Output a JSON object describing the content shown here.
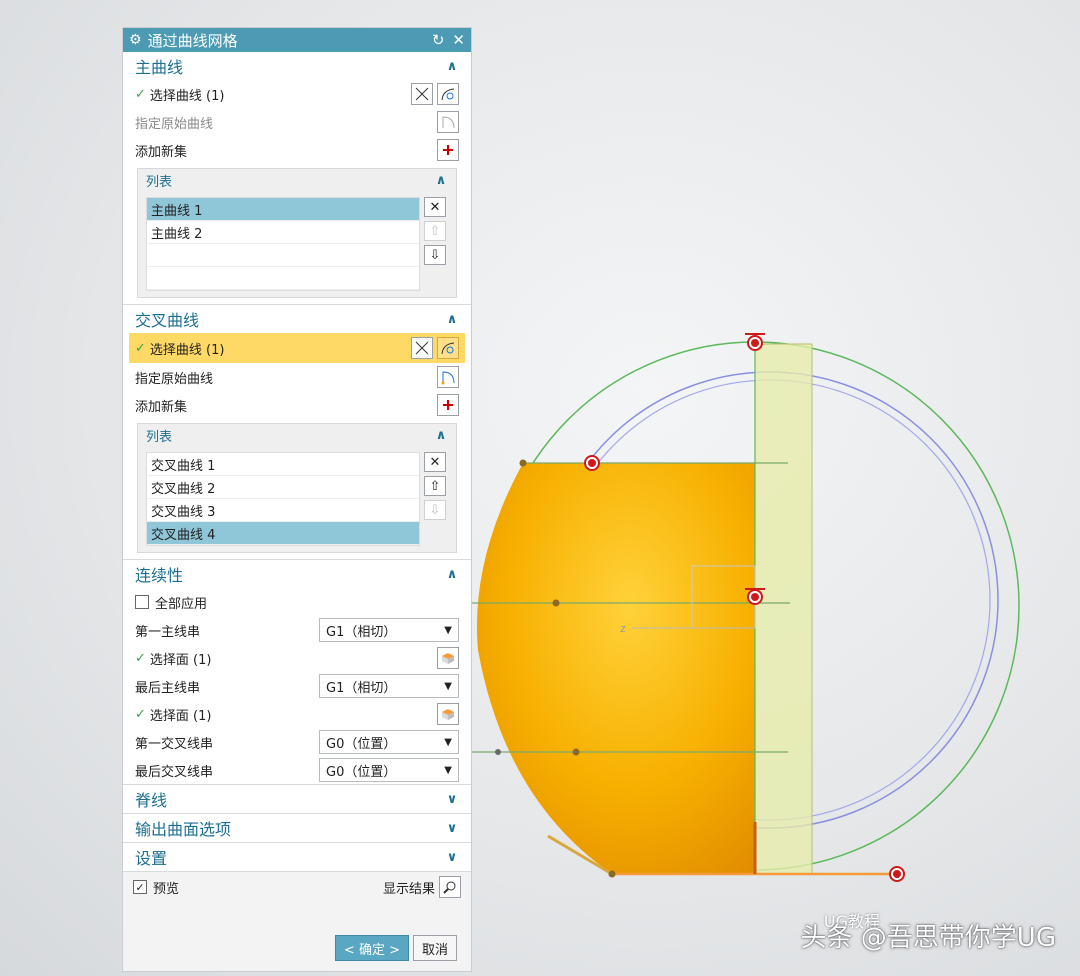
{
  "dialog": {
    "title": "通过曲线网格",
    "reset_glyph": "↻",
    "close_glyph": "✕"
  },
  "main_curves": {
    "header": "主曲线",
    "select_curve": "选择曲线 (1)",
    "specify_origin": "指定原始曲线",
    "add_new_set": "添加新集",
    "list_header": "列表",
    "items": [
      "主曲线 1",
      "主曲线 2"
    ]
  },
  "cross_curves": {
    "header": "交叉曲线",
    "select_curve": "选择曲线 (1)",
    "specify_origin": "指定原始曲线",
    "add_new_set": "添加新集",
    "list_header": "列表",
    "items": [
      "交叉曲线 1",
      "交叉曲线 2",
      "交叉曲线 3",
      "交叉曲线 4"
    ]
  },
  "continuity": {
    "header": "连续性",
    "apply_all": "全部应用",
    "first_primary": "第一主线串",
    "first_primary_value": "G1（相切）",
    "select_face_1": "选择面 (1)",
    "last_primary": "最后主线串",
    "last_primary_value": "G1（相切）",
    "select_face_2": "选择面 (1)",
    "first_cross": "第一交叉线串",
    "first_cross_value": "G0（位置）",
    "last_cross": "最后交叉线串",
    "last_cross_value": "G0（位置）"
  },
  "spine": {
    "header": "脊线"
  },
  "output_options": {
    "header": "输出曲面选项"
  },
  "settings": {
    "header": "设置"
  },
  "footer": {
    "preview": "预览",
    "show_result": "显示结果",
    "ok": "< 确定 >",
    "cancel": "取消"
  },
  "viewport": {
    "axis_label": "z"
  },
  "watermark": {
    "text": "头条 @吾思带你学UG",
    "logo_text": "UG教程"
  },
  "colors": {
    "title_bar": "#4c9ab3",
    "section_header": "#1d6f91",
    "selected_row": "#8fc6d8",
    "highlight": "#ffd966",
    "surface": "#f7a800",
    "curve_green": "#5cb85c",
    "curve_blue": "#8a8fe0"
  }
}
